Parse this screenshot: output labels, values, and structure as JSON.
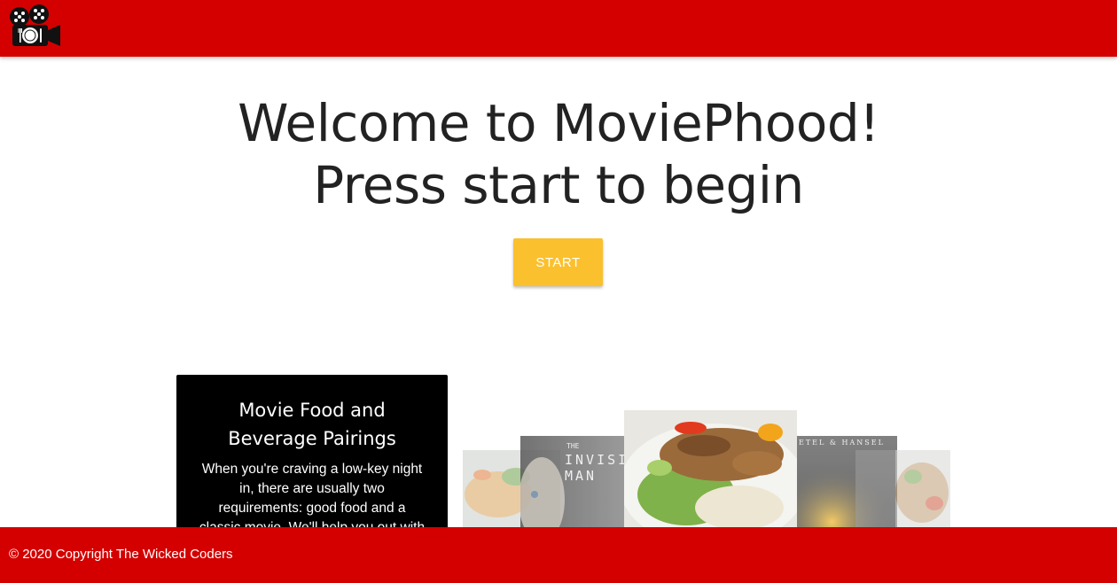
{
  "header": {
    "logo_icon": "film-reel-plate-logo-icon"
  },
  "hero": {
    "title_line1": "Welcome to MoviePhood!",
    "title_line2": "Press start to begin",
    "start_label": "START"
  },
  "info_card": {
    "title": "Movie Food and Beverage Pairings",
    "body": "When you're craving a low-key night in, there are usually two requirements: good food and a classic movie. We'll help you out with that. Sample Pairing:"
  },
  "carousel": {
    "slides": [
      {
        "name": "food-slide-left"
      },
      {
        "name": "movie-poster-invisible-man",
        "title_text": "THE INVISIBLE MAN"
      },
      {
        "name": "food-slide-center"
      },
      {
        "name": "movie-poster-gretel-hansel",
        "title_text": "GRETEL & HANSEL"
      },
      {
        "name": "food-slide-right"
      }
    ]
  },
  "footer": {
    "copyright": "© 2020 Copyright The Wicked Coders"
  },
  "colors": {
    "brand_red": "#d40000",
    "accent_yellow": "#fbc02d"
  }
}
